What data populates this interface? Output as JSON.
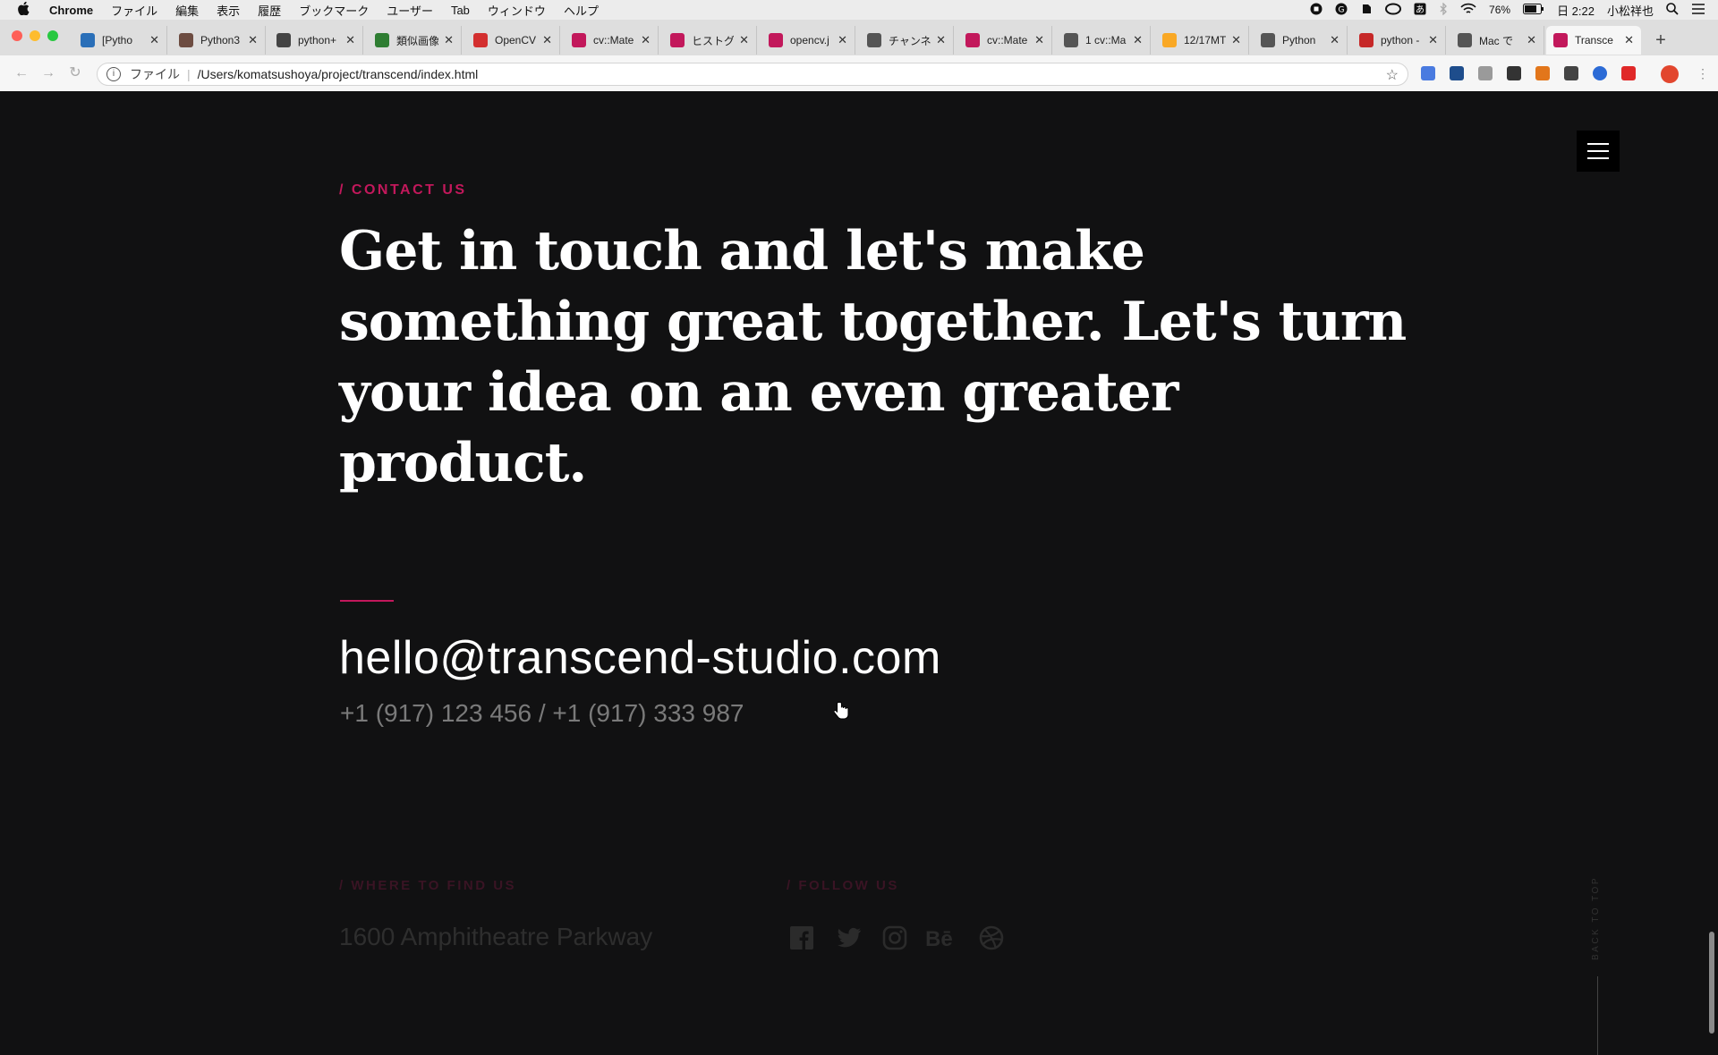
{
  "menubar": {
    "app": "Chrome",
    "items": [
      "ファイル",
      "編集",
      "表示",
      "履歴",
      "ブックマーク",
      "ユーザー",
      "Tab",
      "ウィンドウ",
      "ヘルプ"
    ],
    "battery": "76%",
    "clock": "日 2:22",
    "user": "小松祥也"
  },
  "tabs": [
    {
      "label": "[Pytho",
      "color": "#2a6fb8"
    },
    {
      "label": "Python3",
      "color": "#6d4c41"
    },
    {
      "label": "python+",
      "color": "#444444"
    },
    {
      "label": "類似画像",
      "color": "#2e7d32"
    },
    {
      "label": "OpenCV",
      "color": "#d32f2f"
    },
    {
      "label": "cv::Mate",
      "color": "#c2185b"
    },
    {
      "label": "ヒストグ",
      "color": "#c2185b"
    },
    {
      "label": "opencv.j",
      "color": "#c2185b"
    },
    {
      "label": "チャンネ",
      "color": "#555555"
    },
    {
      "label": "cv::Mate",
      "color": "#c2185b"
    },
    {
      "label": "1 cv::Ma",
      "color": "#555555"
    },
    {
      "label": "12/17MT",
      "color": "#f9a825"
    },
    {
      "label": "Python",
      "color": "#555555"
    },
    {
      "label": "python -",
      "color": "#c62828"
    },
    {
      "label": "Mac で",
      "color": "#555555"
    },
    {
      "label": "Transce",
      "color": "#c2185b"
    }
  ],
  "address": {
    "scheme": "ファイル",
    "url": "/Users/komatsushoya/project/transcend/index.html"
  },
  "page": {
    "eyebrow": "/ CONTACT US",
    "headline": "Get in touch and let's make something great together. Let's turn your idea on an even greater product.",
    "email": "hello@transcend-studio.com",
    "phones": "+1 (917) 123 456 / +1 (917) 333 987",
    "where_label": "/ WHERE TO FIND US",
    "follow_label": "/ FOLLOW US",
    "address": "1600 Amphitheatre Parkway",
    "back_to_top": "BACK TO TOP",
    "social_icons": [
      "facebook-icon",
      "twitter-icon",
      "instagram-icon",
      "behance-icon",
      "dribbble-icon"
    ],
    "accent_color": "#c2185b"
  }
}
